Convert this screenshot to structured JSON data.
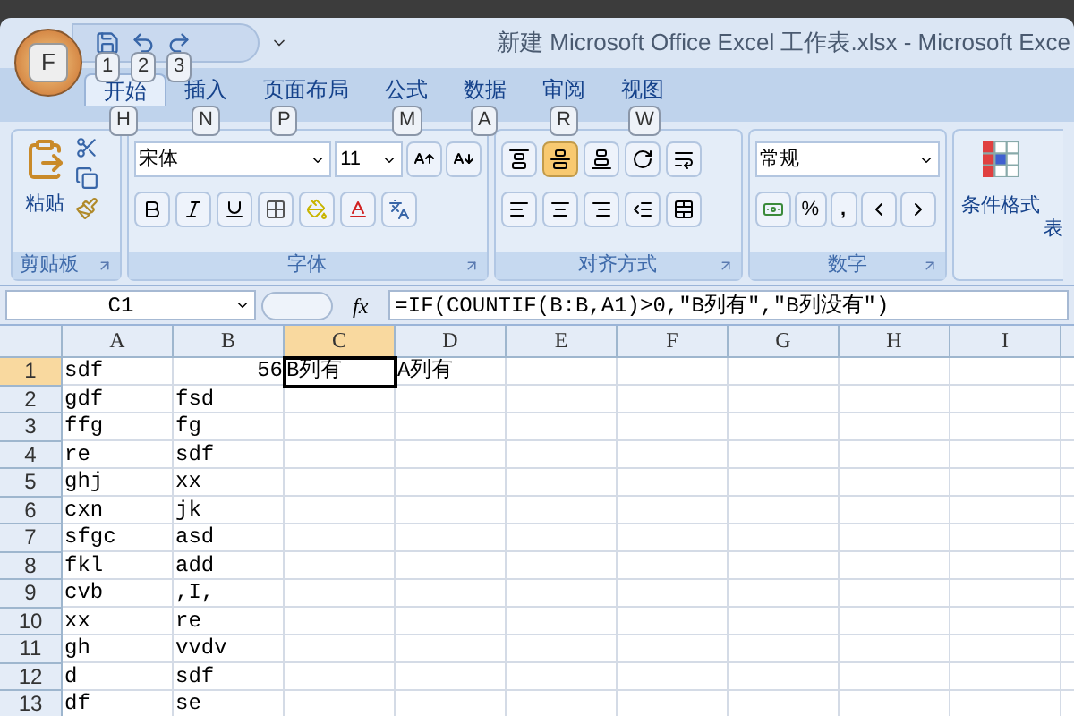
{
  "office_button": {
    "keytip": "F"
  },
  "quick_access": [
    {
      "kind": "save",
      "keytip": "1"
    },
    {
      "kind": "undo",
      "keytip": "2"
    },
    {
      "kind": "redo",
      "keytip": "3"
    }
  ],
  "window": {
    "title": "新建 Microsoft Office Excel 工作表.xlsx - Microsoft Exce"
  },
  "tabs": [
    {
      "label": "开始",
      "keytip": "H",
      "selected": true
    },
    {
      "label": "插入",
      "keytip": "N",
      "selected": false
    },
    {
      "label": "页面布局",
      "keytip": "P",
      "selected": false
    },
    {
      "label": "公式",
      "keytip": "M",
      "selected": false
    },
    {
      "label": "数据",
      "keytip": "A",
      "selected": false
    },
    {
      "label": "审阅",
      "keytip": "R",
      "selected": false
    },
    {
      "label": "视图",
      "keytip": "W",
      "selected": false
    }
  ],
  "ribbon": {
    "clipboard": {
      "title": "剪贴板",
      "paste_label": "粘贴"
    },
    "font": {
      "title": "字体",
      "font_name": "宋体",
      "font_size": "11"
    },
    "alignment": {
      "title": "对齐方式",
      "vertical": [
        {
          "kind": "top",
          "selected": false
        },
        {
          "kind": "middle",
          "selected": true
        },
        {
          "kind": "bottom",
          "selected": false
        }
      ]
    },
    "number": {
      "title": "数字",
      "format": "常规",
      "percent": "%",
      "comma": ","
    },
    "styles": {
      "conditional_format": "条件格式",
      "next_label": "表"
    }
  },
  "formula_bar": {
    "name_box": "C1",
    "function_label": "fx",
    "formula": "=IF(COUNTIF(B:B,A1)>0,\"B列有\",\"B列没有\")"
  },
  "sheet": {
    "columns": [
      {
        "label": "A",
        "selected": false
      },
      {
        "label": "B",
        "selected": false
      },
      {
        "label": "C",
        "selected": true
      },
      {
        "label": "D",
        "selected": false
      },
      {
        "label": "E",
        "selected": false
      },
      {
        "label": "F",
        "selected": false
      },
      {
        "label": "G",
        "selected": false
      },
      {
        "label": "H",
        "selected": false
      },
      {
        "label": "I",
        "selected": false
      }
    ],
    "rows": [
      {
        "number": "1",
        "selected": true,
        "cells": [
          {
            "text": "sdf",
            "kind": "text",
            "selected": false
          },
          {
            "text": "56",
            "kind": "number",
            "selected": false
          },
          {
            "text": "B列有",
            "kind": "text",
            "selected": true
          },
          {
            "text": "A列有",
            "kind": "text",
            "selected": false
          }
        ]
      },
      {
        "number": "2",
        "selected": false,
        "cells": [
          {
            "text": "gdf",
            "kind": "text",
            "selected": false
          },
          {
            "text": "fsd",
            "kind": "text",
            "selected": false
          }
        ]
      },
      {
        "number": "3",
        "selected": false,
        "cells": [
          {
            "text": "ffg",
            "kind": "text",
            "selected": false
          },
          {
            "text": "fg",
            "kind": "text",
            "selected": false
          }
        ]
      },
      {
        "number": "4",
        "selected": false,
        "cells": [
          {
            "text": "re",
            "kind": "text",
            "selected": false
          },
          {
            "text": "sdf",
            "kind": "text",
            "selected": false
          }
        ]
      },
      {
        "number": "5",
        "selected": false,
        "cells": [
          {
            "text": "ghj",
            "kind": "text",
            "selected": false
          },
          {
            "text": "xx",
            "kind": "text",
            "selected": false
          }
        ]
      },
      {
        "number": "6",
        "selected": false,
        "cells": [
          {
            "text": "cxn",
            "kind": "text",
            "selected": false
          },
          {
            "text": "jk",
            "kind": "text",
            "selected": false
          }
        ]
      },
      {
        "number": "7",
        "selected": false,
        "cells": [
          {
            "text": "sfgc",
            "kind": "text",
            "selected": false
          },
          {
            "text": "asd",
            "kind": "text",
            "selected": false
          }
        ]
      },
      {
        "number": "8",
        "selected": false,
        "cells": [
          {
            "text": "fkl",
            "kind": "text",
            "selected": false
          },
          {
            "text": "add",
            "kind": "text",
            "selected": false
          }
        ]
      },
      {
        "number": "9",
        "selected": false,
        "cells": [
          {
            "text": "cvb",
            "kind": "text",
            "selected": false
          },
          {
            "text": ",I,",
            "kind": "text",
            "selected": false
          }
        ]
      },
      {
        "number": "10",
        "selected": false,
        "cells": [
          {
            "text": "xx",
            "kind": "text",
            "selected": false
          },
          {
            "text": "re",
            "kind": "text",
            "selected": false
          }
        ]
      },
      {
        "number": "11",
        "selected": false,
        "cells": [
          {
            "text": "gh",
            "kind": "text",
            "selected": false
          },
          {
            "text": "vvdv",
            "kind": "text",
            "selected": false
          }
        ]
      },
      {
        "number": "12",
        "selected": false,
        "cells": [
          {
            "text": "d",
            "kind": "text",
            "selected": false
          },
          {
            "text": "sdf",
            "kind": "text",
            "selected": false
          }
        ]
      },
      {
        "number": "13",
        "selected": false,
        "cells": [
          {
            "text": "df",
            "kind": "text",
            "selected": false
          },
          {
            "text": "se",
            "kind": "text",
            "selected": false
          }
        ]
      }
    ]
  }
}
